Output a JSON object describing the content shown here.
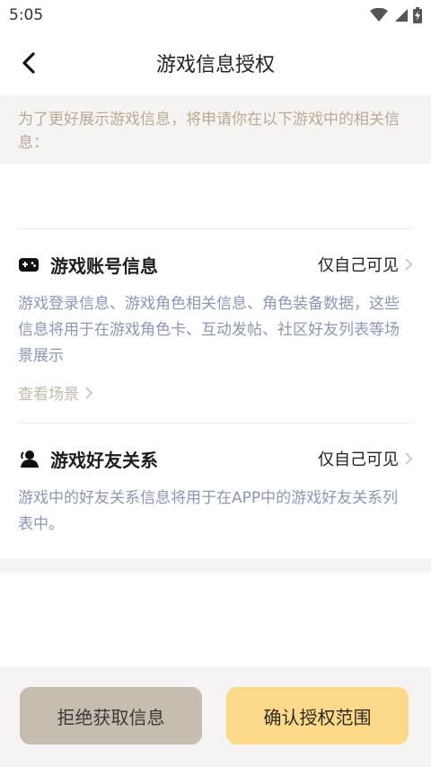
{
  "status_bar": {
    "time": "5:05"
  },
  "header": {
    "title": "游戏信息授权"
  },
  "notice": {
    "text": "为了更好展示游戏信息，将申请你在以下游戏中的相关信息："
  },
  "sections": [
    {
      "title": "游戏账号信息",
      "visibility": "仅自己可见",
      "desc": "游戏登录信息、游戏角色相关信息、角色装备数据，这些信息将用于在游戏角色卡、互动发帖、社区好友列表等场景展示",
      "link": "查看场景"
    },
    {
      "title": "游戏好友关系",
      "visibility": "仅自己可见",
      "desc": "游戏中的好友关系信息将用于在APP中的游戏好友关系列表中。"
    }
  ],
  "buttons": {
    "reject": "拒绝获取信息",
    "confirm": "确认授权范围"
  },
  "colors": {
    "accent": "#fdd98a",
    "reject_bg": "#c4bdb0",
    "desc_text": "#8b97b8",
    "notice_text": "#b9ab93"
  },
  "icons": [
    "back-arrow",
    "wifi",
    "signal",
    "battery-charging",
    "gamepad",
    "friend-user",
    "chevron-right"
  ]
}
